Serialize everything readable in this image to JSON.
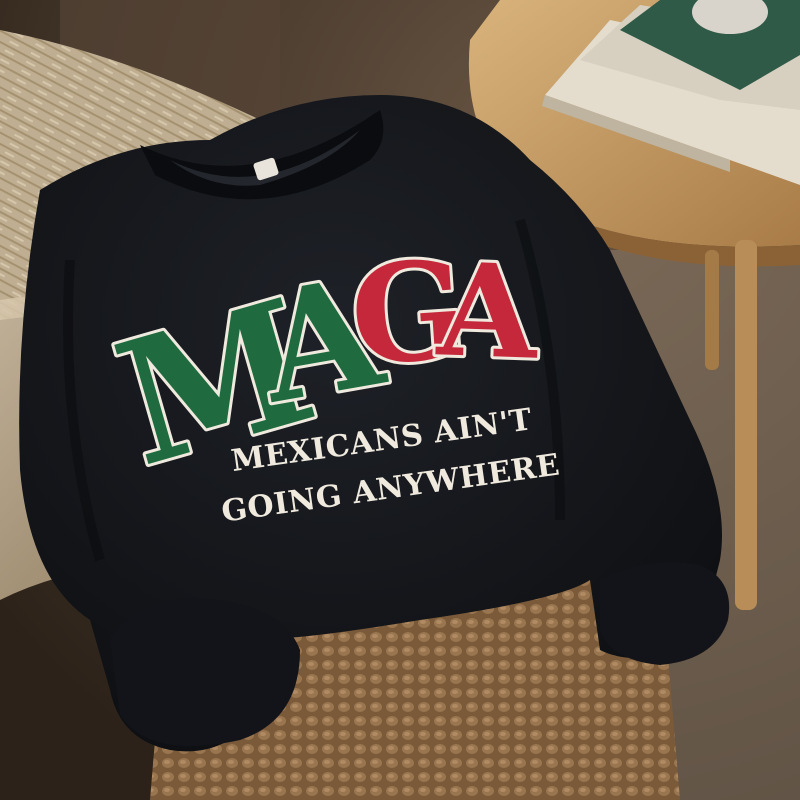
{
  "sweatshirt": {
    "graphic": {
      "letters": [
        {
          "char": "M",
          "color": "#1f6b3f"
        },
        {
          "char": "A",
          "color": "#1f6b3f"
        },
        {
          "char": "G",
          "color": "#c5283a"
        },
        {
          "char": "A",
          "color": "#c5283a"
        }
      ],
      "line_1": "MEXICANS AIN'T",
      "line_2": "GOING ANYWHERE"
    },
    "fabric_color": "#14161b"
  },
  "colors": {
    "green": "#1f6b3f",
    "red": "#c5283a",
    "outline": "#efe9de",
    "table_wood": "#c9a06a",
    "blanket": "#8a6844",
    "throw": "#c8b69a"
  }
}
